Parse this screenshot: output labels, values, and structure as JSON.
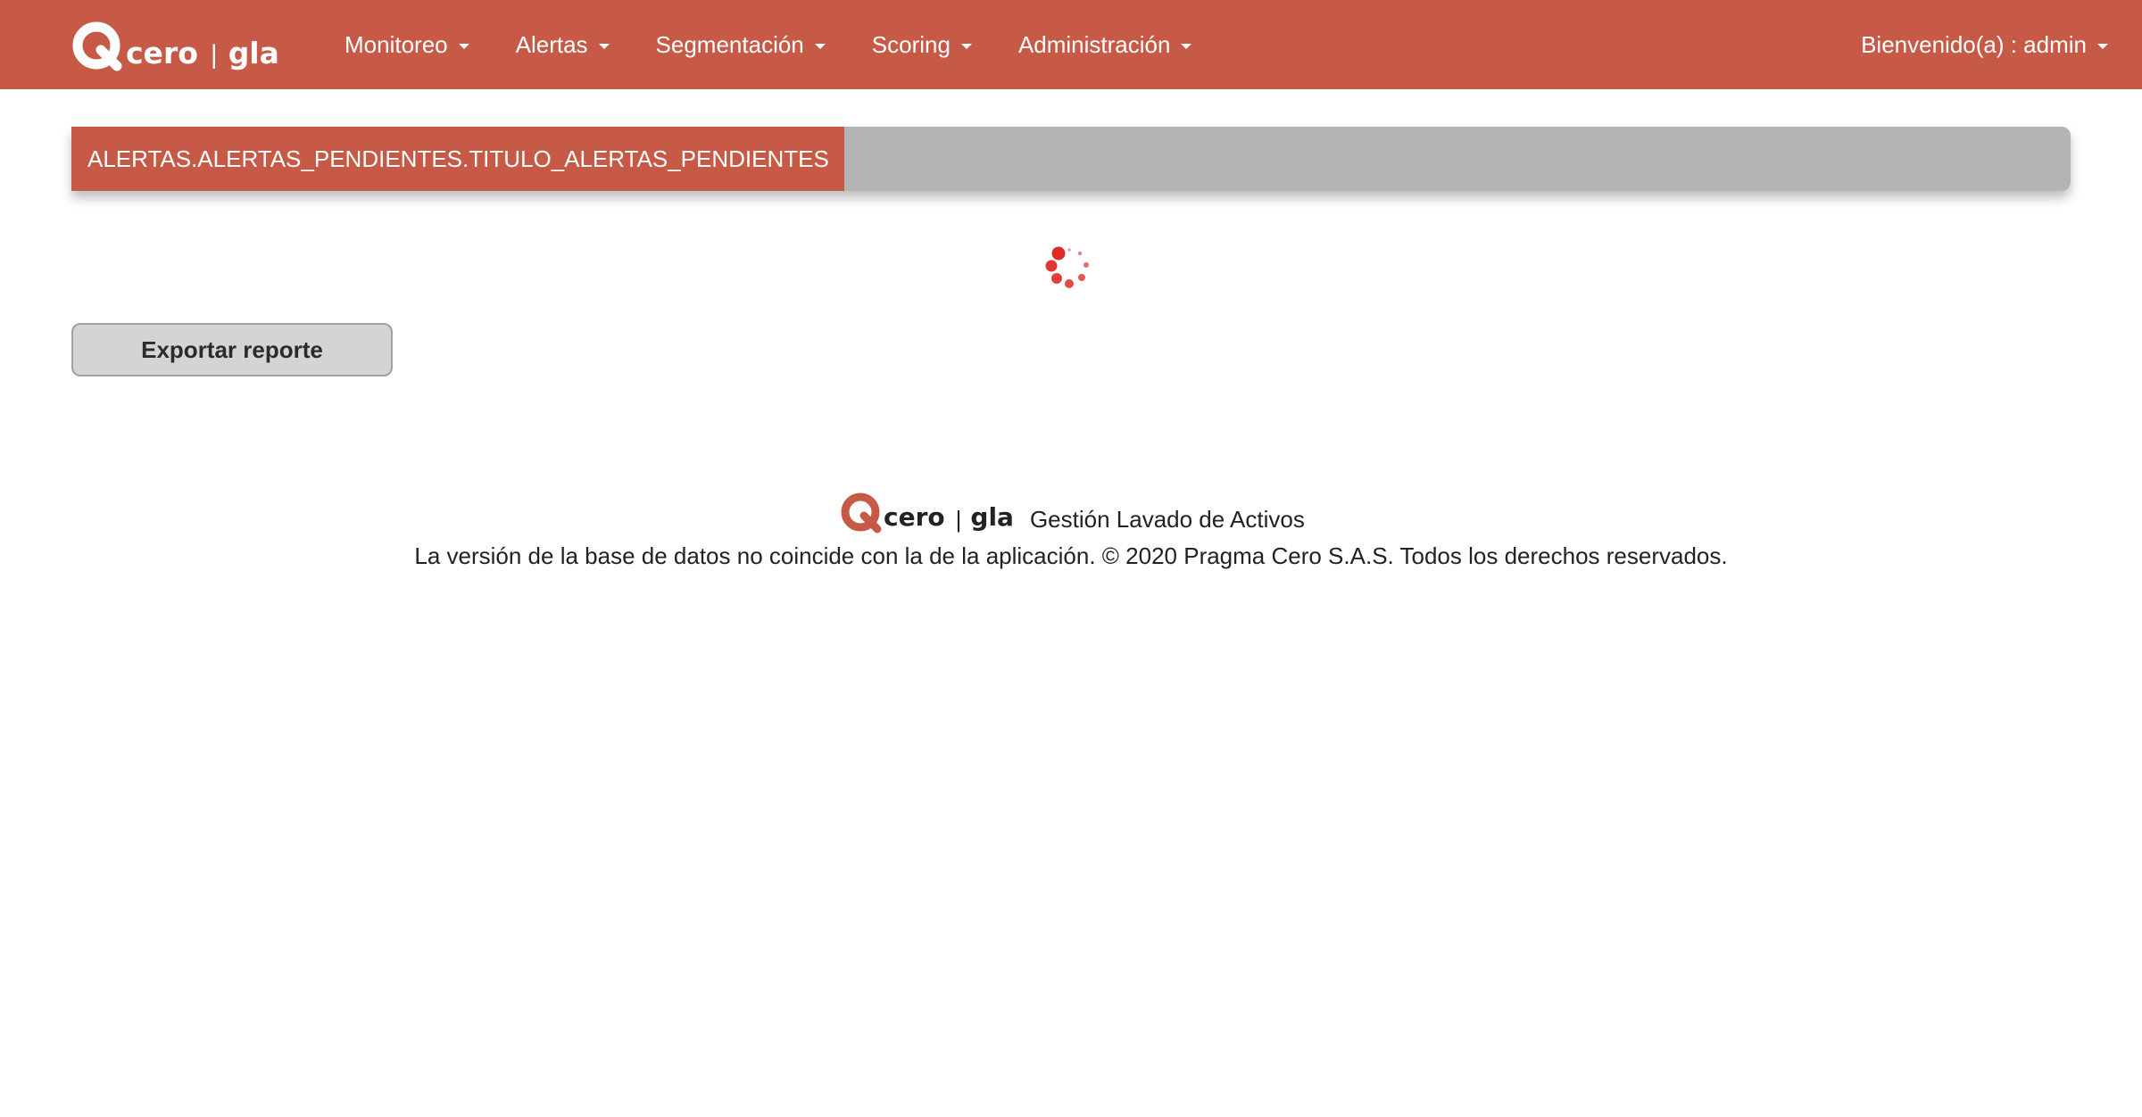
{
  "navbar": {
    "brand": {
      "name": "cero",
      "product": "gla"
    },
    "menu": [
      {
        "label": "Monitoreo"
      },
      {
        "label": "Alertas"
      },
      {
        "label": "Segmentación"
      },
      {
        "label": "Scoring"
      },
      {
        "label": "Administración"
      }
    ],
    "user_label": "Bienvenido(a) : admin"
  },
  "title_panel": {
    "label": "ALERTAS.ALERTAS_PENDIENTES.TITULO_ALERTAS_PENDIENTES"
  },
  "actions": {
    "export_label": "Exportar reporte"
  },
  "footer": {
    "brand": {
      "name": "cero",
      "product": "gla"
    },
    "tagline": "Gestión Lavado de Activos",
    "message": "La versión de la base de datos no coincide con la de la aplicación. © 2020 Pragma Cero S.A.S. Todos los derechos reservados."
  },
  "colors": {
    "brand": "#c75a47",
    "panel_gray": "#b4b4b4",
    "button_gray": "#d4d4d4",
    "spinner_red": "#e02a2a"
  },
  "icons": {
    "loading": "loading-spinner-icon",
    "caret": "caret-down-icon",
    "logo": "cero-logo-icon"
  }
}
